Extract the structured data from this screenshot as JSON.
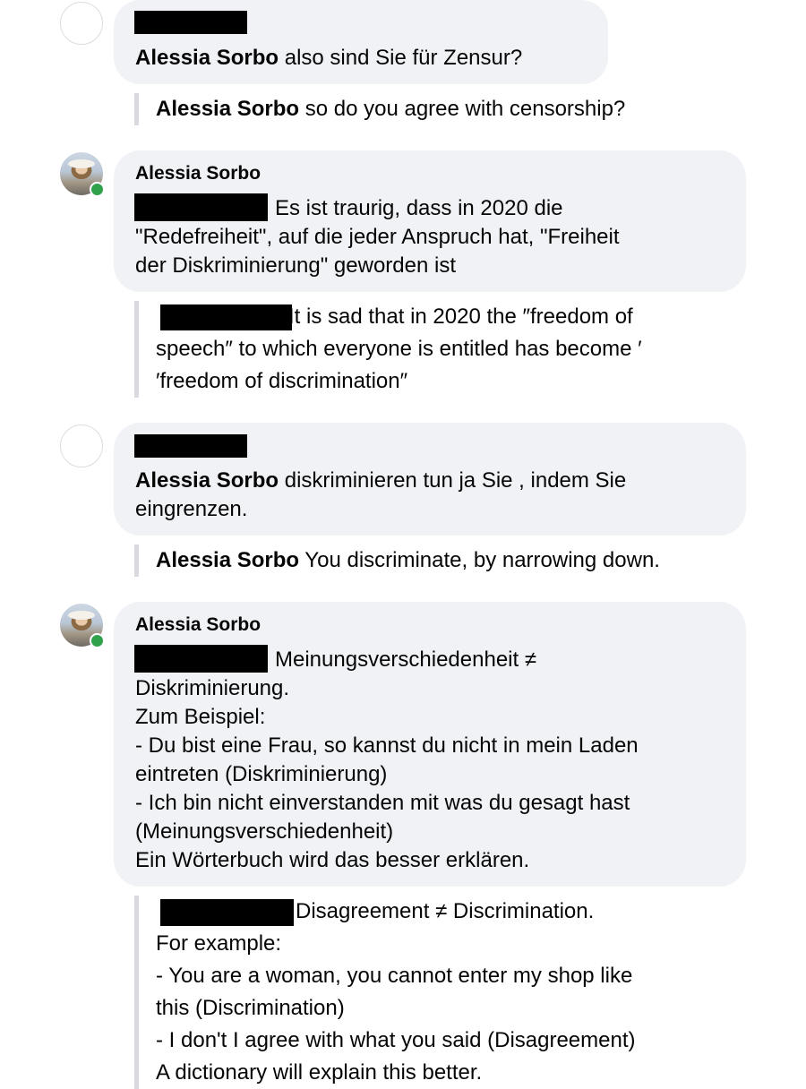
{
  "thread": {
    "c1": {
      "name": "Alessia Sorbo",
      "text": " also sind Sie für Zensur?",
      "translation_name": "Alessia Sorbo",
      "translation_text": " so do you agree with censorship?"
    },
    "c2": {
      "author": "Alessia Sorbo",
      "text_lines": [
        "Es ist traurig, dass in 2020 die",
        "\"Redefreiheit\", auf die jeder Anspruch hat, \"Freiheit",
        "der Diskriminierung\" geworden ist"
      ],
      "translation_lines": [
        "It is sad that in 2020 the ″freedom of",
        "speech″ to which everyone is entitled has become ′",
        "′freedom of discrimination″"
      ]
    },
    "c3": {
      "name": "Alessia Sorbo",
      "text_lines": [
        " diskriminieren tun ja Sie , indem Sie",
        "eingrenzen."
      ],
      "translation_name": "Alessia Sorbo",
      "translation_text": " You discriminate, by narrowing down."
    },
    "c4": {
      "author": "Alessia Sorbo",
      "text_lines": [
        "Meinungsverschiedenheit ≠",
        "Diskriminierung.",
        "Zum Beispiel:",
        "- Du bist eine Frau, so kannst du nicht in mein Laden",
        "eintreten (Diskriminierung)",
        "- Ich bin nicht einverstanden mit was du gesagt hast",
        "(Meinungsverschiedenheit)",
        "Ein Wörterbuch wird das besser erklären."
      ],
      "translation_lines": [
        "Disagreement ≠ Discrimination.",
        "For example:",
        "- You are a woman, you cannot enter my shop like",
        "this (Discrimination)",
        "- I don't I agree with what you said (Disagreement)",
        "A dictionary will explain this better."
      ]
    }
  },
  "icons": {
    "online": "online-status-dot",
    "avatar_default": "default-avatar-icon",
    "avatar_photo": "profile-photo"
  },
  "colors": {
    "bubble_bg": "#f0f2f5",
    "online": "#31a24c",
    "quote_bar": "#d8dadf"
  }
}
